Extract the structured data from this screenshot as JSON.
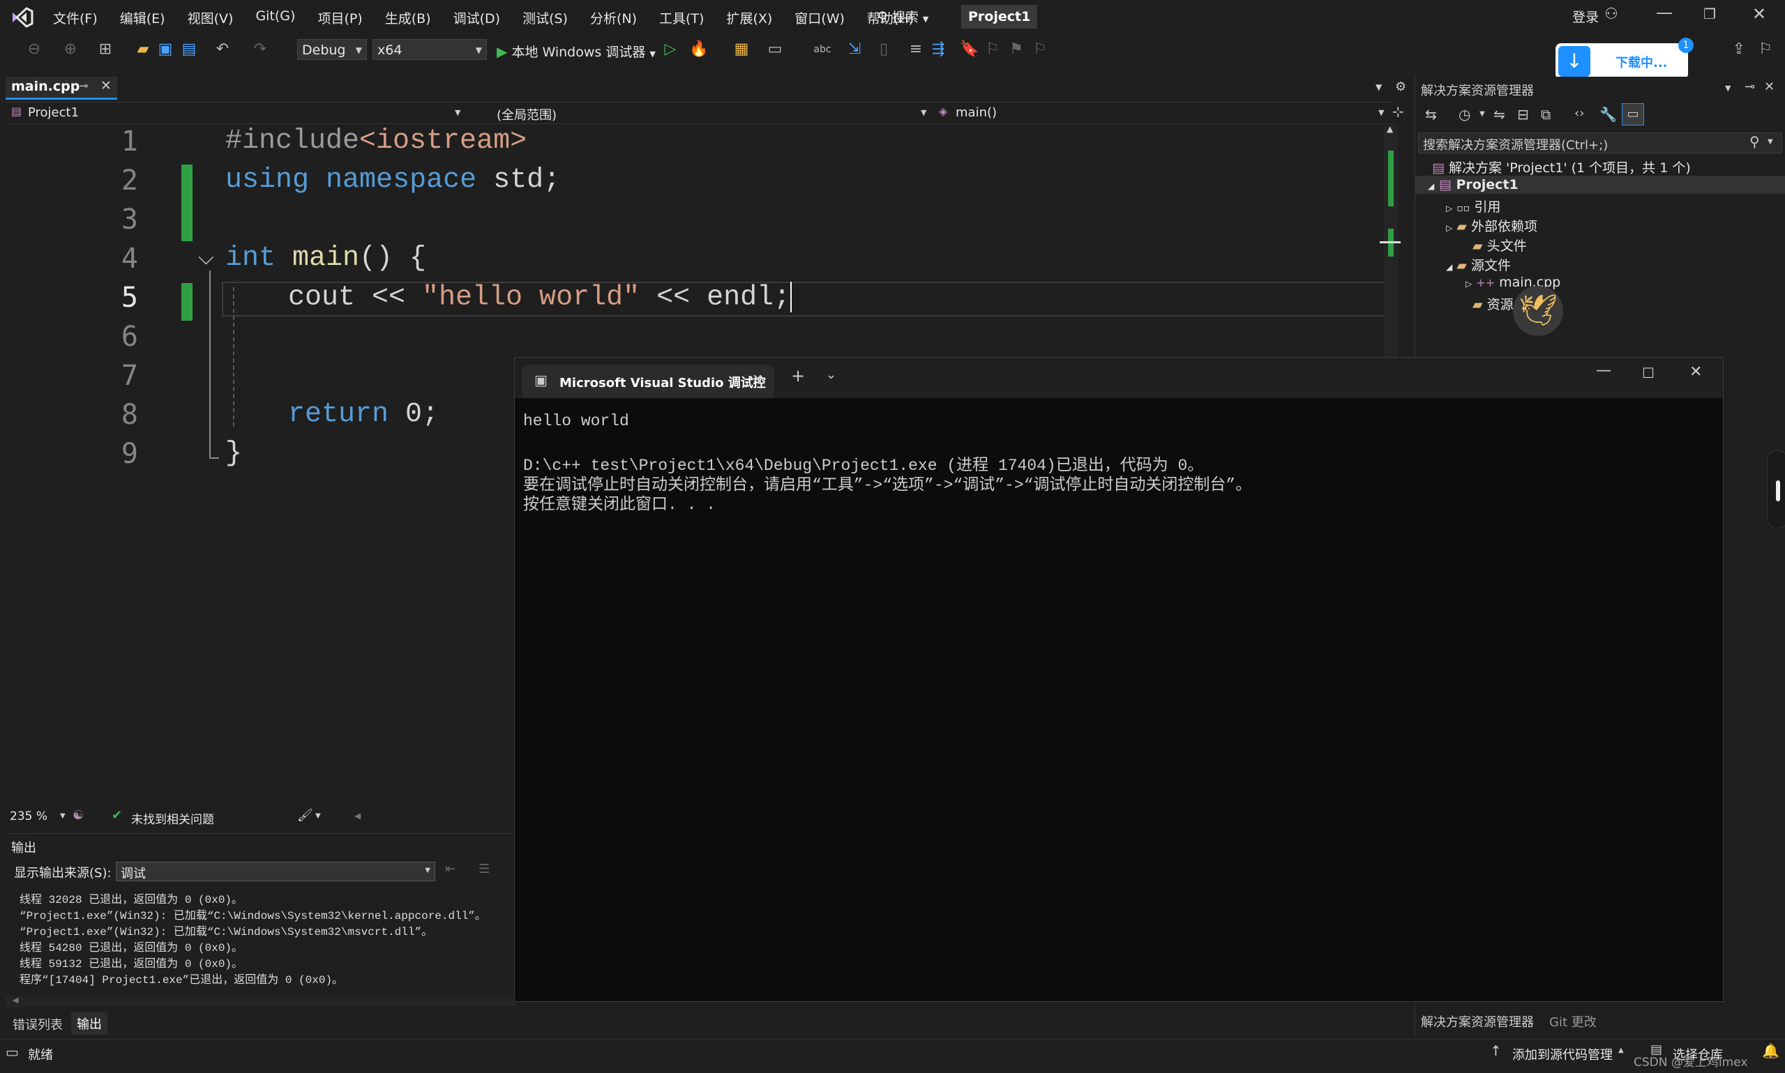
{
  "menu": [
    "文件(F)",
    "编辑(E)",
    "视图(V)",
    "Git(G)",
    "项目(P)",
    "生成(B)",
    "调试(D)",
    "测试(S)",
    "分析(N)",
    "工具(T)",
    "扩展(X)",
    "窗口(W)",
    "帮助(H)"
  ],
  "search_label": "搜索",
  "project_badge": "Project1",
  "login_label": "登录",
  "toolbar": {
    "config": "Debug",
    "platform": "x64",
    "run_label": "本地 Windows 调试器"
  },
  "download": {
    "label": "下载中...",
    "badge": "1"
  },
  "editor": {
    "tab_name": "main.cpp",
    "nav_project": "Project1",
    "nav_scope": "(全局范围)",
    "nav_member": "main()",
    "line_numbers": [
      "1",
      "2",
      "3",
      "4",
      "5",
      "6",
      "7",
      "8",
      "9"
    ],
    "code": {
      "l1_pre": "#include",
      "l1_header": "<iostream>",
      "l2_kw1": "using",
      "l2_kw2": "namespace",
      "l2_rest": " std;",
      "l4_kw": "int",
      "l4_fn": " main",
      "l4_rest": "() {",
      "l5_a": "cout << ",
      "l5_str": "\"hello world\"",
      "l5_b": " << endl;",
      "l8_kw": "return",
      "l8_rest": " 0;",
      "l9": "}"
    },
    "zoom": "235 %",
    "issues": "未找到相关问题"
  },
  "console": {
    "tab_title": "Microsoft Visual Studio 调试控",
    "lines": [
      "hello world",
      "",
      "D:\\c++ test\\Project1\\x64\\Debug\\Project1.exe (进程 17404)已退出，代码为 0。",
      "要在调试停止时自动关闭控制台，请启用“工具”->“选项”->“调试”->“调试停止时自动关闭控制台”。",
      "按任意键关闭此窗口. . ."
    ]
  },
  "solution_explorer": {
    "title": "解决方案资源管理器",
    "search_placeholder": "搜索解决方案资源管理器(Ctrl+;)",
    "solution": "解决方案 'Project1' (1 个项目，共 1 个)",
    "project": "Project1",
    "items": [
      "引用",
      "外部依赖项",
      "头文件",
      "源文件",
      "main.cpp",
      "资源"
    ],
    "bottom_tabs": [
      "解决方案资源管理器",
      "Git 更改"
    ]
  },
  "output": {
    "title": "输出",
    "source_label": "显示输出来源(S):",
    "source_value": "调试",
    "lines": [
      "线程 32028 已退出，返回值为 0 (0x0)。",
      "“Project1.exe”(Win32): 已加载“C:\\Windows\\System32\\kernel.appcore.dll”。",
      "“Project1.exe”(Win32): 已加载“C:\\Windows\\System32\\msvcrt.dll”。",
      "线程 54280 已退出，返回值为 0 (0x0)。",
      "线程 59132 已退出，返回值为 0 (0x0)。",
      "程序“[17404] Project1.exe”已退出，返回值为 0 (0x0)。"
    ],
    "bottom_tabs": [
      "错误列表",
      "输出"
    ]
  },
  "status": {
    "ready": "就绪",
    "source_control": "添加到源代码管理",
    "repo": "选择仓库",
    "watermark": "CSDN @爱上鸡lmex"
  },
  "colors": {
    "accent": "#1e90ff",
    "editor_bg": "#1f1f1f",
    "console_bg": "#0c0c0c",
    "changebar": "#2ea043"
  }
}
